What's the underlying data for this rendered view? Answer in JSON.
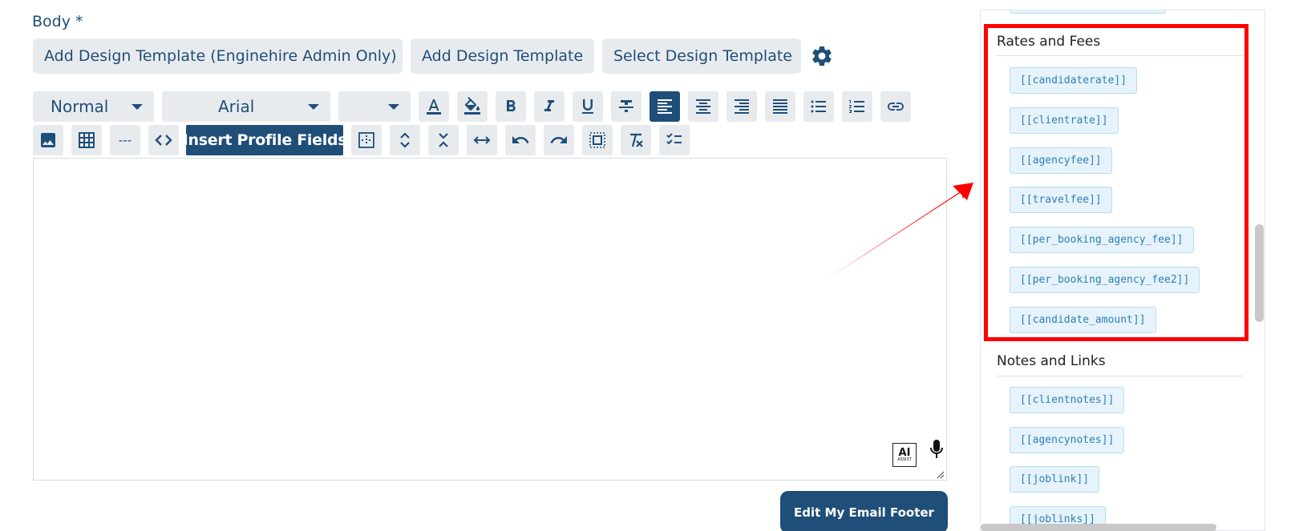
{
  "body_label": "Body *",
  "template_buttons": {
    "admin": "Add Design Template (Enginehire Admin Only)",
    "add": "Add Design Template",
    "select": "Select Design Template"
  },
  "toolbar": {
    "style_select": "Normal",
    "font_select": "Arial",
    "size_select": "",
    "insert_profile_fields": "Insert Profile Fields",
    "hr_label": "---",
    "code_label": "<>"
  },
  "ai_assist": {
    "ai": "AI",
    "assist": "ASSIST"
  },
  "footer_button": "Edit My Email Footer",
  "sections": [
    {
      "title": "Rates and Fees",
      "fields": [
        "[[candidaterate]]",
        "[[clientrate]]",
        "[[agencyfee]]",
        "[[travelfee]]",
        "[[per_booking_agency_fee]]",
        "[[per_booking_agency_fee2]]",
        "[[candidate_amount]]"
      ]
    },
    {
      "title": "Notes and Links",
      "fields": [
        "[[clientnotes]]",
        "[[agencynotes]]",
        "[[joblink]]",
        "[[joblinks]]"
      ]
    }
  ],
  "colors": {
    "primary": "#1f4e79",
    "button_bg": "#e8ebee",
    "chip_bg": "#e6f3fb",
    "chip_text": "#2c7fb8",
    "highlight": "#ff0000"
  }
}
